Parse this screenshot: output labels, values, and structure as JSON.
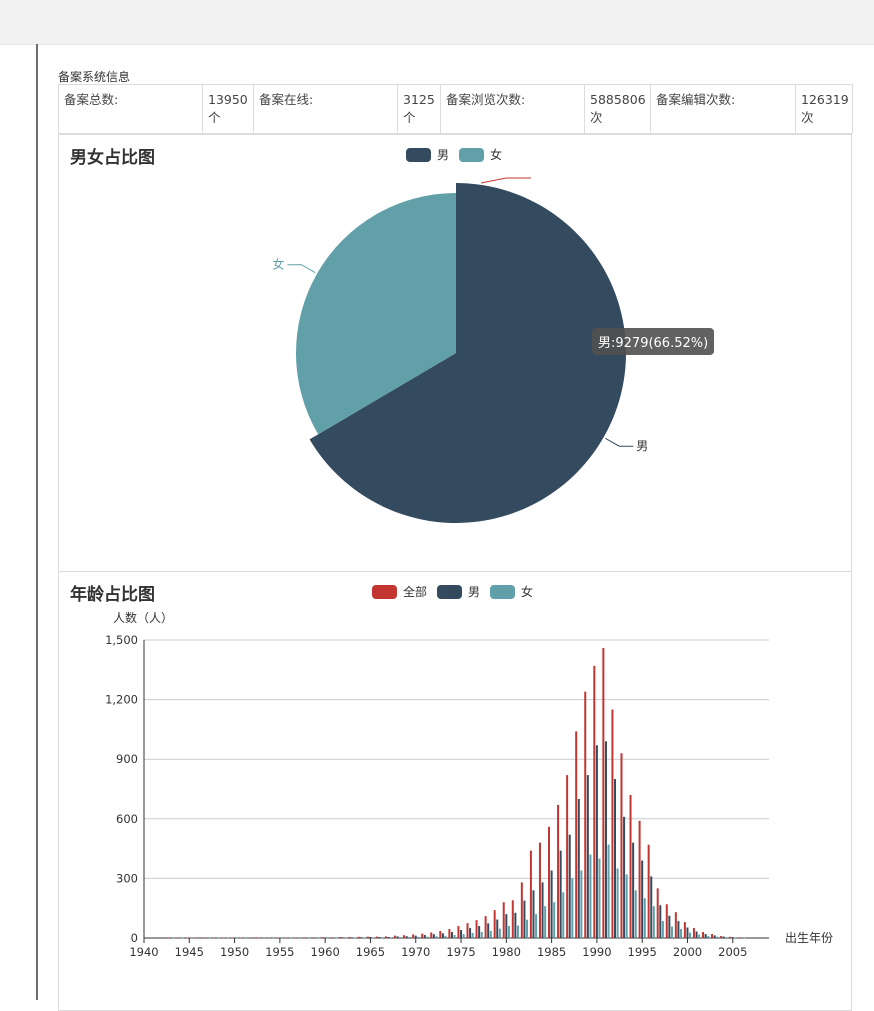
{
  "section_title": "备案系统信息",
  "stats": [
    {
      "label": "备案总数:",
      "value": "13950",
      "unit": "个"
    },
    {
      "label": "备案在线:",
      "value": "3125",
      "unit": "个"
    },
    {
      "label": "备案浏览次数:",
      "value": "5885806",
      "unit": "次"
    },
    {
      "label": "备案编辑次数:",
      "value": "126319",
      "unit": "次"
    }
  ],
  "gender_panel": {
    "title": "男女占比图",
    "legend": [
      "男",
      "女"
    ],
    "colors": {
      "male": "#344a5e",
      "female": "#61a0a8",
      "all": "#c23531"
    },
    "tooltip": "男:9279(66.52%)"
  },
  "age_panel": {
    "title": "年龄占比图",
    "legend": [
      "全部",
      "男",
      "女"
    ]
  },
  "chart_data": [
    {
      "type": "pie",
      "title": "男女占比图",
      "legend": [
        "男",
        "女"
      ],
      "slices": [
        {
          "name": "男",
          "value": 9279,
          "percent": 66.52
        },
        {
          "name": "女",
          "value": 4671,
          "percent": 33.48
        }
      ]
    },
    {
      "type": "bar",
      "title": "年龄占比图",
      "ylabel": "人数（人）",
      "xlabel": "出生年份",
      "ylim": [
        0,
        1500
      ],
      "yticks": [
        "0",
        "300",
        "600",
        "900",
        "1,200",
        "1,500"
      ],
      "xticks": [
        "1940",
        "1945",
        "1950",
        "1955",
        "1960",
        "1965",
        "1970",
        "1975",
        "1980",
        "1985",
        "1990",
        "1995",
        "2000",
        "2005"
      ],
      "legend": [
        "全部",
        "男",
        "女"
      ],
      "x": [
        1943,
        1944,
        1945,
        1946,
        1947,
        1948,
        1949,
        1950,
        1951,
        1952,
        1953,
        1954,
        1955,
        1956,
        1957,
        1958,
        1959,
        1960,
        1961,
        1962,
        1963,
        1964,
        1965,
        1966,
        1967,
        1968,
        1969,
        1970,
        1971,
        1972,
        1973,
        1974,
        1975,
        1976,
        1977,
        1978,
        1979,
        1980,
        1981,
        1982,
        1983,
        1984,
        1985,
        1986,
        1987,
        1988,
        1989,
        1990,
        1991,
        1992,
        1993,
        1994,
        1995,
        1996,
        1997,
        1998,
        1999,
        2000,
        2001,
        2002,
        2003,
        2004,
        2005,
        2006
      ],
      "series": [
        {
          "name": "全部",
          "values": [
            3,
            2,
            2,
            1,
            2,
            2,
            2,
            2,
            2,
            1,
            2,
            2,
            2,
            2,
            2,
            3,
            3,
            4,
            3,
            5,
            5,
            6,
            7,
            7,
            8,
            12,
            14,
            18,
            22,
            28,
            35,
            45,
            60,
            75,
            90,
            110,
            140,
            180,
            190,
            280,
            440,
            480,
            560,
            670,
            820,
            1040,
            1240,
            1370,
            1460,
            1150,
            930,
            720,
            590,
            470,
            250,
            170,
            130,
            80,
            50,
            30,
            20,
            10,
            6,
            3
          ]
        },
        {
          "name": "男",
          "values": [
            2,
            1,
            1,
            1,
            1,
            1,
            1,
            1,
            1,
            1,
            1,
            1,
            1,
            1,
            1,
            2,
            2,
            3,
            2,
            3,
            3,
            4,
            5,
            5,
            5,
            8,
            9,
            12,
            15,
            19,
            24,
            30,
            40,
            50,
            60,
            74,
            93,
            120,
            127,
            188,
            240,
            280,
            340,
            440,
            520,
            700,
            820,
            970,
            990,
            800,
            610,
            480,
            390,
            310,
            165,
            112,
            85,
            53,
            33,
            20,
            13,
            7,
            4,
            2
          ]
        },
        {
          "name": "女",
          "values": [
            1,
            1,
            1,
            0,
            1,
            1,
            1,
            1,
            1,
            0,
            1,
            1,
            1,
            1,
            1,
            1,
            1,
            1,
            1,
            2,
            2,
            2,
            2,
            2,
            3,
            4,
            5,
            6,
            7,
            9,
            11,
            15,
            20,
            25,
            30,
            36,
            47,
            60,
            63,
            92,
            120,
            160,
            180,
            230,
            300,
            340,
            420,
            400,
            470,
            350,
            320,
            240,
            200,
            160,
            85,
            58,
            45,
            27,
            17,
            10,
            7,
            3,
            2,
            1
          ]
        }
      ]
    }
  ]
}
